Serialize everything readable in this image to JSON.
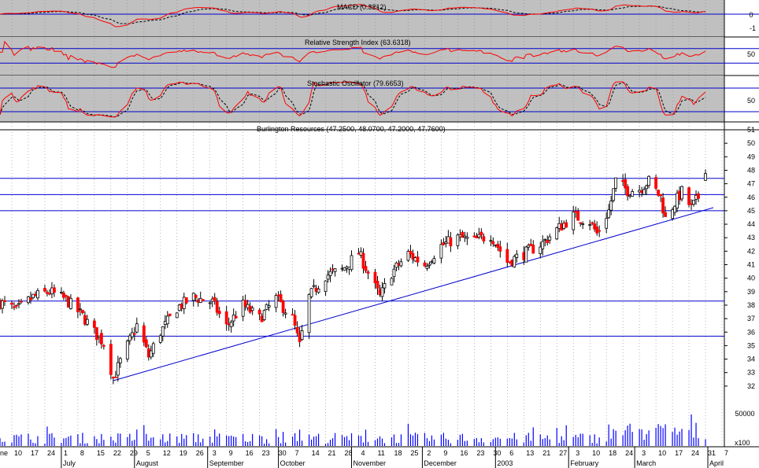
{
  "chart_data": {
    "type": "candlestick",
    "instrument": "Burlington Resources",
    "price_title": "Burlington Resources (47.2500, 48.0700, 47.2000, 47.7600)",
    "ohlc_last": {
      "open": 47.25,
      "high": 48.07,
      "low": 47.2,
      "close": 47.76
    },
    "ylim": [
      31,
      51
    ],
    "y_ticks": [
      32,
      33,
      34,
      35,
      36,
      37,
      38,
      39,
      40,
      41,
      42,
      43,
      44,
      45,
      46,
      47,
      48,
      49,
      50,
      51
    ],
    "horizontal_lines": [
      47.4,
      46.2,
      45.0,
      38.3,
      35.7
    ],
    "trend_line": {
      "start": {
        "date": "2002-07-23",
        "price": 32.4
      },
      "end": {
        "date": "2003-03-31",
        "price": 45.2
      }
    },
    "x_range": [
      "2002-06-05",
      "2003-04-08"
    ],
    "date_tick_labels": [
      "10",
      "17",
      "24",
      "1",
      "8",
      "15",
      "22",
      "29",
      "5",
      "12",
      "19",
      "26",
      "3",
      "9",
      "16",
      "23",
      "30",
      "7",
      "14",
      "21",
      "28",
      "4",
      "11",
      "18",
      "25",
      "2",
      "9",
      "16",
      "23",
      "30",
      "6",
      "13",
      "21",
      "27",
      "3",
      "10",
      "18",
      "24",
      "3",
      "10",
      "17",
      "24",
      "31",
      "7"
    ],
    "month_labels": [
      "July",
      "August",
      "September",
      "October",
      "November",
      "December",
      "2003",
      "February",
      "March",
      "April"
    ],
    "first_label_fragment": "ne",
    "close_waypoints": [
      {
        "date": "2002-06-05",
        "price": 38.2
      },
      {
        "date": "2002-06-12",
        "price": 37.6
      },
      {
        "date": "2002-06-19",
        "price": 38.6
      },
      {
        "date": "2002-06-26",
        "price": 39.0
      },
      {
        "date": "2002-07-03",
        "price": 38.4
      },
      {
        "date": "2002-07-10",
        "price": 37.2
      },
      {
        "date": "2002-07-15",
        "price": 36.0
      },
      {
        "date": "2002-07-19",
        "price": 35.2
      },
      {
        "date": "2002-07-23",
        "price": 32.6
      },
      {
        "date": "2002-07-29",
        "price": 35.0
      },
      {
        "date": "2002-08-02",
        "price": 36.5
      },
      {
        "date": "2002-08-07",
        "price": 34.2
      },
      {
        "date": "2002-08-12",
        "price": 36.0
      },
      {
        "date": "2002-08-19",
        "price": 37.8
      },
      {
        "date": "2002-08-26",
        "price": 38.6
      },
      {
        "date": "2002-09-03",
        "price": 38.2
      },
      {
        "date": "2002-09-09",
        "price": 36.4
      },
      {
        "date": "2002-09-16",
        "price": 38.0
      },
      {
        "date": "2002-09-23",
        "price": 37.0
      },
      {
        "date": "2002-09-30",
        "price": 38.5
      },
      {
        "date": "2002-10-07",
        "price": 37.0
      },
      {
        "date": "2002-10-10",
        "price": 35.0
      },
      {
        "date": "2002-10-14",
        "price": 38.6
      },
      {
        "date": "2002-10-21",
        "price": 40.2
      },
      {
        "date": "2002-10-28",
        "price": 40.6
      },
      {
        "date": "2002-11-04",
        "price": 41.9
      },
      {
        "date": "2002-11-08",
        "price": 40.4
      },
      {
        "date": "2002-11-13",
        "price": 38.6
      },
      {
        "date": "2002-11-18",
        "price": 40.4
      },
      {
        "date": "2002-11-25",
        "price": 41.8
      },
      {
        "date": "2002-12-02",
        "price": 41.0
      },
      {
        "date": "2002-12-09",
        "price": 42.4
      },
      {
        "date": "2002-12-16",
        "price": 43.0
      },
      {
        "date": "2002-12-23",
        "price": 42.8
      },
      {
        "date": "2002-12-30",
        "price": 43.2
      },
      {
        "date": "2003-01-06",
        "price": 41.2
      },
      {
        "date": "2003-01-13",
        "price": 41.8
      },
      {
        "date": "2003-01-21",
        "price": 42.6
      },
      {
        "date": "2003-01-27",
        "price": 43.6
      },
      {
        "date": "2003-02-03",
        "price": 44.6
      },
      {
        "date": "2003-02-10",
        "price": 44.2
      },
      {
        "date": "2003-02-13",
        "price": 43.3
      },
      {
        "date": "2003-02-18",
        "price": 45.0
      },
      {
        "date": "2003-02-21",
        "price": 47.2
      },
      {
        "date": "2003-02-26",
        "price": 46.5
      },
      {
        "date": "2003-03-03",
        "price": 46.6
      },
      {
        "date": "2003-03-07",
        "price": 47.2
      },
      {
        "date": "2003-03-12",
        "price": 46.0
      },
      {
        "date": "2003-03-14",
        "price": 44.4
      },
      {
        "date": "2003-03-18",
        "price": 45.6
      },
      {
        "date": "2003-03-21",
        "price": 46.4
      },
      {
        "date": "2003-03-25",
        "price": 45.2
      },
      {
        "date": "2003-03-28",
        "price": 46.0
      },
      {
        "date": "2003-03-31",
        "price": 47.76
      }
    ],
    "indicators": {
      "macd": {
        "title": "MACD (0.3212)",
        "y_ticks": [
          "0",
          "-1"
        ]
      },
      "rsi": {
        "title": "Relative Strength Index (63.6318)",
        "y_ticks": [
          "50"
        ]
      },
      "stochastic": {
        "title": "Stochastic Oscillator (79.6653)",
        "y_ticks": [
          "50"
        ]
      }
    },
    "volume": {
      "tick": "50000",
      "unit": "x100"
    },
    "colors": {
      "up_candle": "#000000",
      "down_candle": "#ff0000",
      "indicator_line": "#ff0000",
      "signal_line": "#000000",
      "reference_line": "#0000cc",
      "indicator_bg": "#c0c0c0",
      "volume": "#0000ff",
      "grid": "#888888"
    }
  }
}
